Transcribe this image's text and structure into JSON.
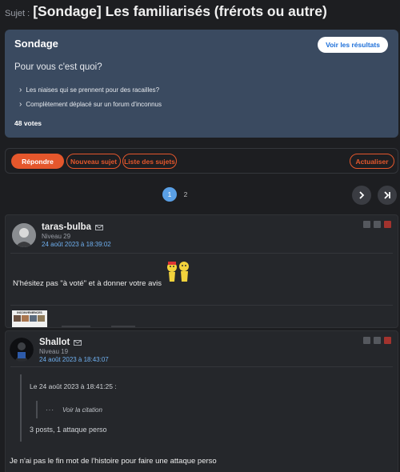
{
  "topic": {
    "prefix": "Sujet :",
    "title": "[Sondage] Les familiarisés (frérots ou autre)"
  },
  "poll": {
    "label": "Sondage",
    "results_button": "Voir les résultats",
    "question": "Pour vous c'est quoi?",
    "options": [
      {
        "label": "Les niaises qui se prennent pour des racailles?"
      },
      {
        "label": "Complètement déplacé sur un forum d'inconnus"
      }
    ],
    "votes": "48 votes"
  },
  "actions": {
    "reply": "Répondre",
    "new_topic": "Nouveau sujet",
    "topic_list": "Liste des sujets",
    "refresh": "Actualiser"
  },
  "pagination": {
    "current": "1",
    "other": "2"
  },
  "posts": [
    {
      "author": "taras-bulba",
      "level": "Niveau 29",
      "date": "24 août 2023 à 18:39:02",
      "text": "N'hésitez pas \"à voté\" et à donner votre avis",
      "thumbnail_text": "INCONVENIENCES"
    },
    {
      "author": "Shallot",
      "level": "Niveau 19",
      "date": "24 août 2023 à 18:43:07",
      "quote_header": "Le 24 août 2023 à 18:41:25 :",
      "quote_link": "Voir la citation",
      "quote_dots": "···",
      "quote_body": "3 posts, 1 attaque perso",
      "text": "Je n'ai pas le fin mot de l'histoire pour faire une attaque perso"
    }
  ],
  "colors": {
    "accent": "#e5572c",
    "poll_bg": "#3a4a60",
    "link": "#6fb0f0",
    "page_current": "#5aa0e6"
  }
}
